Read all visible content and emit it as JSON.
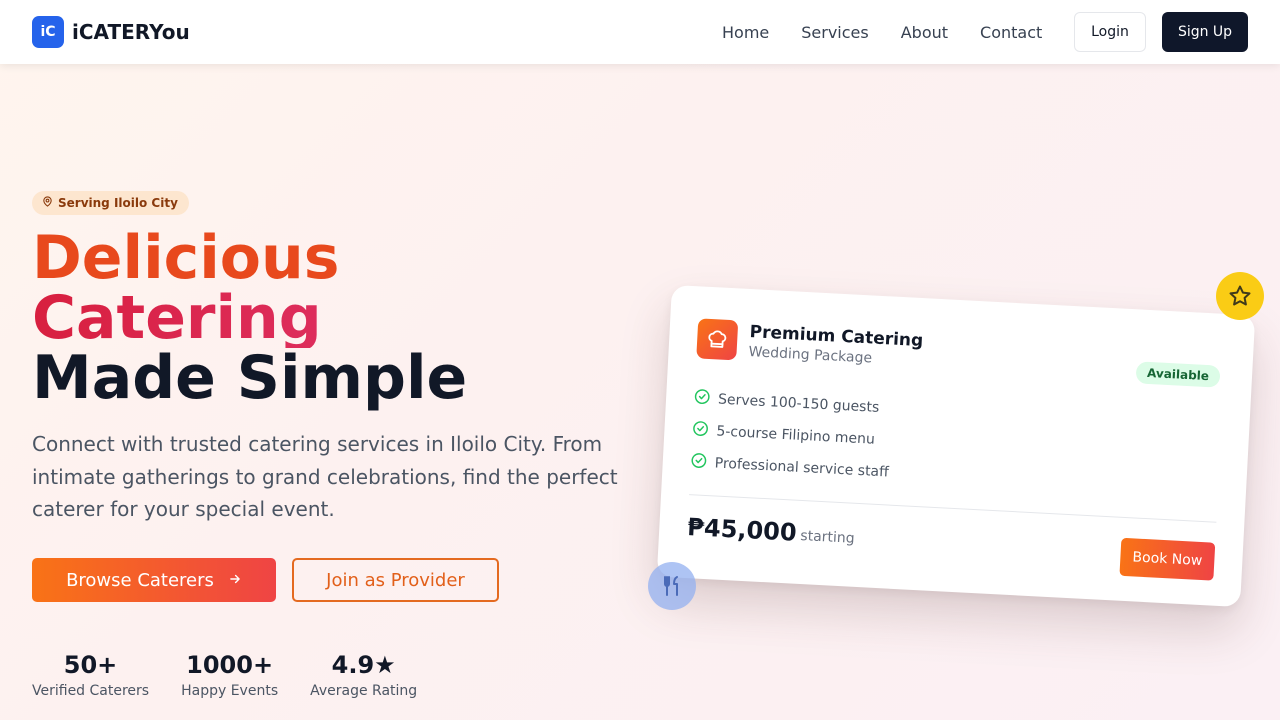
{
  "brand": {
    "badge": "iC",
    "name": "iCATERYou"
  },
  "nav": {
    "links": [
      "Home",
      "Services",
      "About",
      "Contact"
    ],
    "login": "Login",
    "signup": "Sign Up"
  },
  "hero": {
    "location_pill": "Serving Iloilo City",
    "headline": [
      "Delicious",
      "Catering",
      "Made Simple"
    ],
    "description": "Connect with trusted catering services in Iloilo City. From intimate gatherings to grand celebrations, find the perfect caterer for your special event.",
    "primary_cta": "Browse Caterers",
    "secondary_cta": "Join as Provider",
    "stats": [
      {
        "value": "50+",
        "label": "Verified Caterers"
      },
      {
        "value": "1000+",
        "label": "Happy Events"
      },
      {
        "value": "4.9★",
        "label": "Average Rating"
      }
    ]
  },
  "card": {
    "title": "Premium Catering",
    "subtitle": "Wedding Package",
    "badge": "Available",
    "features": [
      "Serves 100-150 guests",
      "5-course Filipino menu",
      "Professional service staff"
    ],
    "price": "₱45,000",
    "price_note": "starting",
    "cta": "Book Now"
  },
  "icons": {
    "location": "map-pin-icon",
    "arrow": "arrow-right-icon",
    "chef": "chef-hat-icon",
    "check": "check-circle-icon",
    "star": "star-icon",
    "utensils": "utensils-icon"
  },
  "colors": {
    "brand_blue": "#2563eb",
    "orange": "#f97316",
    "red": "#ef4444",
    "navy": "#0f172a",
    "yellow": "#facc15",
    "green_badge": "#dcfce7"
  }
}
